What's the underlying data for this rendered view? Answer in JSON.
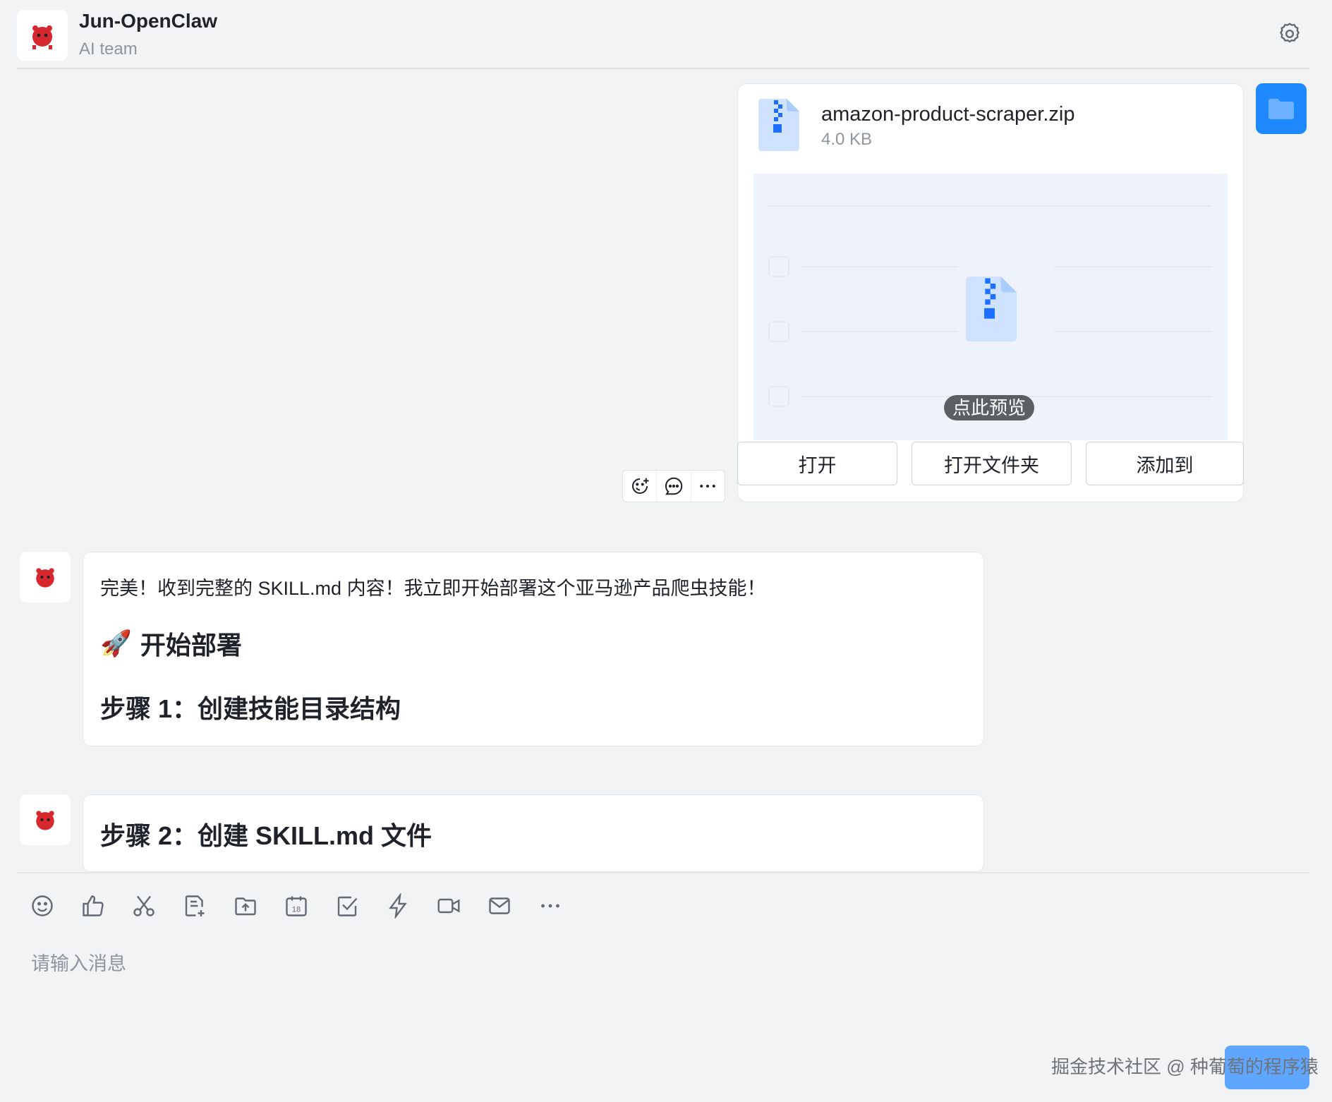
{
  "header": {
    "title": "Jun-OpenClaw",
    "subtitle": "AI team"
  },
  "file_card": {
    "file_name": "amazon-product-scraper.zip",
    "file_size": "4.0 KB",
    "preview_label": "点此预览",
    "buttons": [
      "打开",
      "打开文件夹",
      "添加到"
    ]
  },
  "messages": [
    {
      "text": "完美！收到完整的 SKILL.md 内容！我立即开始部署这个亚马逊产品爬虫技能！",
      "heading": "开始部署",
      "heading_emoji": "🚀",
      "subheading": "步骤 1：创建技能目录结构"
    },
    {
      "subheading": "步骤 2：创建 SKILL.md 文件"
    }
  ],
  "input": {
    "placeholder": "请输入消息"
  },
  "toolbar_icons": [
    "emoji-icon",
    "thumbs-up-icon",
    "scissors-icon",
    "doc-add-icon",
    "folder-upload-icon",
    "calendar-icon",
    "checkbox-icon",
    "lightning-icon",
    "video-icon",
    "mail-icon",
    "more-icon"
  ],
  "calendar_day": "18",
  "watermark": "掘金技术社区 @ 种葡萄的程序猿",
  "colors": {
    "accent": "#1e88ff",
    "background": "#f2f3f5",
    "bubble": "#ffffff"
  }
}
